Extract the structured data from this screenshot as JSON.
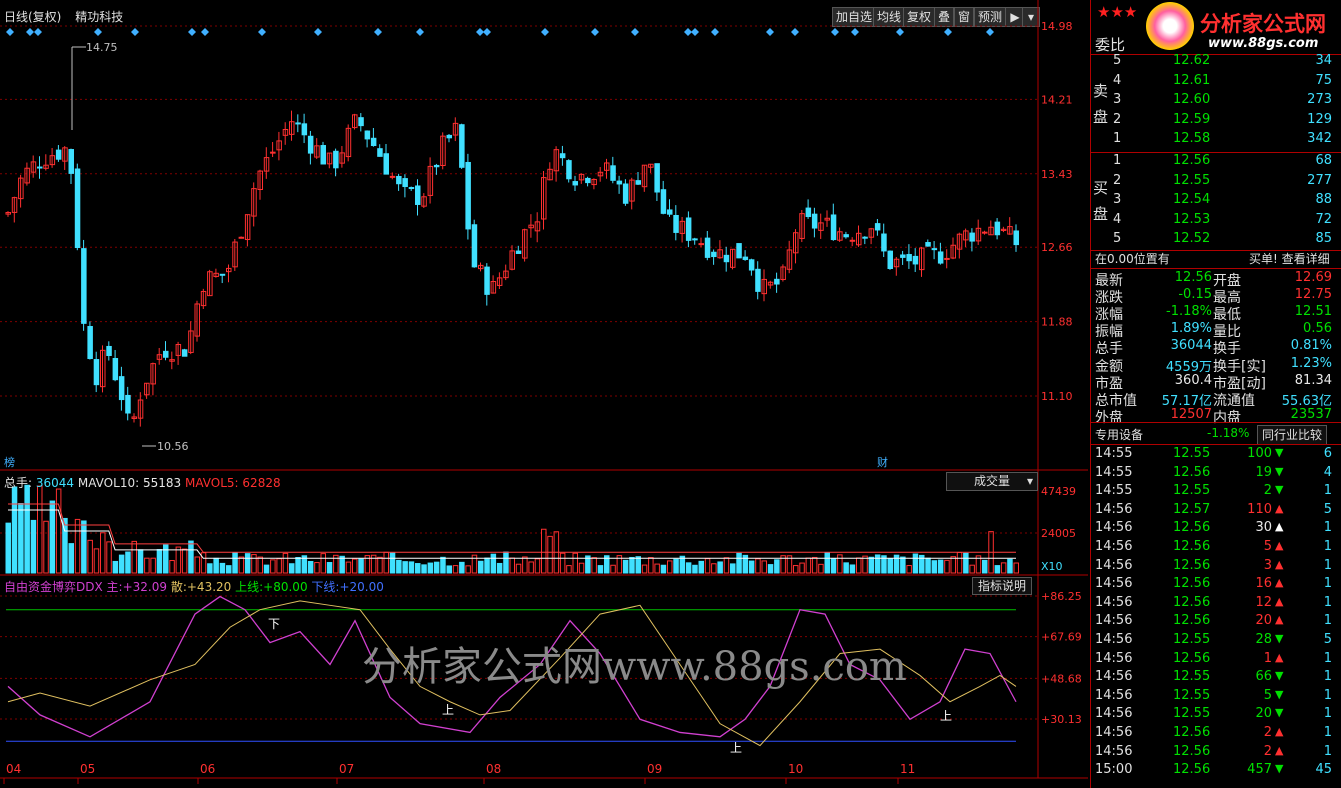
{
  "window_title": "日线(复权)",
  "stock_name": "精功科技",
  "toolbar": {
    "buttons": [
      "加自选",
      "均线",
      "复权",
      "叠",
      "窗",
      "预测"
    ],
    "extra_icon": "arrow-right-icon",
    "dropdown_icon": "caret-down-icon"
  },
  "logo": {
    "title": "分析家公式网",
    "url": "www.88gs.com",
    "stars": "★★★"
  },
  "price_axis": [
    "14.98",
    "14.21",
    "13.43",
    "12.66",
    "11.88",
    "11.10"
  ],
  "high_marker": "14.75",
  "low_marker": "10.56",
  "bottom_flags": {
    "left": "榜",
    "right": "财"
  },
  "volume_header": {
    "total_label": "总手:",
    "total_value": "36044",
    "mavol10_label": "MAVOL10:",
    "mavol10_value": "55183",
    "mavol5_label": "MAVOL5:",
    "mavol5_value": "62828",
    "indicator_select": "成交量",
    "axis": [
      "47439",
      "24005",
      "X10"
    ]
  },
  "ddx_header": {
    "name": "自由资金博弈DDX",
    "main_label": "主:",
    "main_value": "+32.09",
    "san_label": "散:",
    "san_value": "+43.20",
    "upper_label": "上线:",
    "upper_value": "+80.00",
    "lower_label": "下线:",
    "lower_value": "+20.00",
    "help_button": "指标说明",
    "axis": [
      "+86.25",
      "+67.69",
      "+48.68",
      "+30.13"
    ],
    "marks": [
      "下",
      "上",
      "上",
      "上"
    ]
  },
  "watermark": "分析家公式网www.88gs.com",
  "month_axis": [
    "04",
    "05",
    "06",
    "07",
    "08",
    "09",
    "10",
    "11"
  ],
  "order_book": {
    "header": "委比",
    "sell_label": "卖盘",
    "buy_label": "买盘",
    "sells": [
      {
        "lvl": "5",
        "price": "12.62",
        "vol": "34"
      },
      {
        "lvl": "4",
        "price": "12.61",
        "vol": "75"
      },
      {
        "lvl": "3",
        "price": "12.60",
        "vol": "273"
      },
      {
        "lvl": "2",
        "price": "12.59",
        "vol": "129"
      },
      {
        "lvl": "1",
        "price": "12.58",
        "vol": "342"
      }
    ],
    "buys": [
      {
        "lvl": "1",
        "price": "12.56",
        "vol": "68"
      },
      {
        "lvl": "2",
        "price": "12.55",
        "vol": "277"
      },
      {
        "lvl": "3",
        "price": "12.54",
        "vol": "88"
      },
      {
        "lvl": "4",
        "price": "12.53",
        "vol": "72"
      },
      {
        "lvl": "5",
        "price": "12.52",
        "vol": "85"
      }
    ]
  },
  "position_info": {
    "left": "在0.00位置有",
    "right": "买单! 查看详细"
  },
  "quote": [
    {
      "l1": "最新",
      "v1": "12.56",
      "c1": "grn",
      "l2": "开盘",
      "v2": "12.69",
      "c2": "red"
    },
    {
      "l1": "涨跌",
      "v1": "-0.15",
      "c1": "grn",
      "l2": "最高",
      "v2": "12.75",
      "c2": "red"
    },
    {
      "l1": "涨幅",
      "v1": "-1.18%",
      "c1": "grn",
      "l2": "最低",
      "v2": "12.51",
      "c2": "grn"
    },
    {
      "l1": "振幅",
      "v1": "1.89%",
      "c1": "cyan",
      "l2": "量比",
      "v2": "0.56",
      "c2": "grn"
    },
    {
      "l1": "总手",
      "v1": "36044",
      "c1": "cyan",
      "l2": "换手",
      "v2": "0.81%",
      "c2": "cyan"
    },
    {
      "l1": "金额",
      "v1": "4559万",
      "c1": "cyan",
      "l2": "换手[实]",
      "v2": "1.23%",
      "c2": "cyan"
    },
    {
      "l1": "市盈",
      "v1": "360.4",
      "c1": "wht",
      "l2": "市盈[动]",
      "v2": "81.34",
      "c2": "wht"
    },
    {
      "l1": "总市值",
      "v1": "57.17亿",
      "c1": "cyan",
      "l2": "流通值",
      "v2": "55.63亿",
      "c2": "cyan"
    },
    {
      "l1": "外盘",
      "v1": "12507",
      "c1": "red",
      "l2": "内盘",
      "v2": "23537",
      "c2": "grn"
    }
  ],
  "sector": {
    "name": "专用设备",
    "change": "-1.18%",
    "button": "同行业比较"
  },
  "ticks": [
    {
      "t": "14:55",
      "p": "12.55",
      "v": "100",
      "d": "down",
      "n": "6"
    },
    {
      "t": "14:55",
      "p": "12.56",
      "v": "19",
      "d": "down",
      "n": "4"
    },
    {
      "t": "14:55",
      "p": "12.55",
      "v": "2",
      "d": "down",
      "n": "1"
    },
    {
      "t": "14:56",
      "p": "12.57",
      "v": "110",
      "d": "up",
      "n": "5"
    },
    {
      "t": "14:56",
      "p": "12.56",
      "v": "30",
      "d": "upw",
      "n": "1"
    },
    {
      "t": "14:56",
      "p": "12.56",
      "v": "5",
      "d": "up",
      "n": "1"
    },
    {
      "t": "14:56",
      "p": "12.56",
      "v": "3",
      "d": "up",
      "n": "1"
    },
    {
      "t": "14:56",
      "p": "12.56",
      "v": "16",
      "d": "up",
      "n": "1"
    },
    {
      "t": "14:56",
      "p": "12.56",
      "v": "12",
      "d": "up",
      "n": "1"
    },
    {
      "t": "14:56",
      "p": "12.56",
      "v": "20",
      "d": "up",
      "n": "1"
    },
    {
      "t": "14:56",
      "p": "12.55",
      "v": "28",
      "d": "down",
      "n": "5"
    },
    {
      "t": "14:56",
      "p": "12.56",
      "v": "1",
      "d": "up",
      "n": "1"
    },
    {
      "t": "14:56",
      "p": "12.55",
      "v": "66",
      "d": "down",
      "n": "1"
    },
    {
      "t": "14:56",
      "p": "12.55",
      "v": "5",
      "d": "down",
      "n": "1"
    },
    {
      "t": "14:56",
      "p": "12.55",
      "v": "20",
      "d": "down",
      "n": "1"
    },
    {
      "t": "14:56",
      "p": "12.56",
      "v": "2",
      "d": "up",
      "n": "1"
    },
    {
      "t": "14:56",
      "p": "12.56",
      "v": "2",
      "d": "up",
      "n": "1"
    },
    {
      "t": "15:00",
      "p": "12.56",
      "v": "457",
      "d": "down",
      "n": "45"
    }
  ],
  "colors": {
    "up": "#ff3030",
    "down": "#40e0ff",
    "ma": "#ffffff",
    "ddx_main": "#d040d0",
    "ddx_san": "#e0c060",
    "upper": "#00c000",
    "lower": "#3050ff",
    "grid": "#800000"
  }
}
